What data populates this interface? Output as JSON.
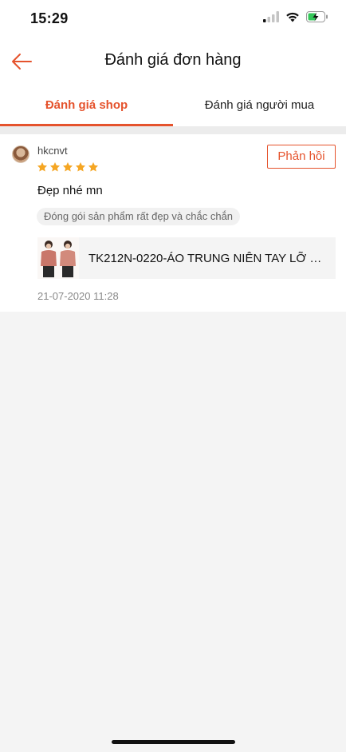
{
  "status_bar": {
    "time": "15:29"
  },
  "header": {
    "title": "Đánh giá đơn hàng"
  },
  "tabs": [
    {
      "label": "Đánh giá shop",
      "active": true
    },
    {
      "label": "Đánh giá người mua",
      "active": false
    }
  ],
  "review": {
    "username": "hkcnvt",
    "rating": 5,
    "reply_label": "Phản hồi",
    "comment": "Đẹp nhé mn",
    "tag": "Đóng gói sản phẩm rất đẹp và chắc chắn",
    "product_name": "TK212N-0220-ÁO TRUNG NIÊN TAY LỠ B...",
    "date": "21-07-2020 11:28"
  },
  "colors": {
    "accent": "#e5532d",
    "star": "#f5a623",
    "background": "#f4f4f4"
  }
}
